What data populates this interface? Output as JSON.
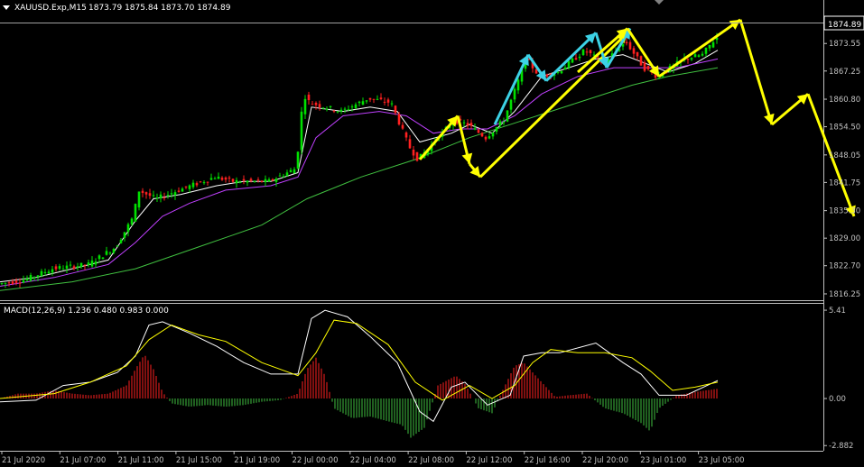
{
  "window": {
    "symbol": "XAUUSD.Exp,M15",
    "ohlc": "1873.79 1875.84 1873.70 1874.89",
    "current_price": "1874.89",
    "menu_arrow": "triangle-down-icon"
  },
  "colors": {
    "background": "#000000",
    "axis": "#c0c0c0",
    "bull": "#00e000",
    "bear": "#ff2020",
    "ma_fast": "#ffffff",
    "ma_slow": "#c040ff",
    "ma_long": "#40c040",
    "arrow_yellow": "#ffff00",
    "arrow_cyan": "#3cd2e6",
    "macd_line": "#ffffff",
    "signal_line": "#ffff00"
  },
  "chart_data": [
    {
      "type": "candlestick",
      "title": "XAUUSD.Exp,M15",
      "y_ticks": [
        "1873.55",
        "1867.25",
        "1860.80",
        "1854.50",
        "1848.05",
        "1841.75",
        "1835.30",
        "1829.00",
        "1822.70",
        "1816.25"
      ],
      "ylim": [
        1814.8,
        1880.2
      ],
      "x_ticks": [
        "21 Jul 2020",
        "21 Jul 07:00",
        "21 Jul 11:00",
        "21 Jul 15:00",
        "21 Jul 19:00",
        "22 Jul 00:00",
        "22 Jul 04:00",
        "22 Jul 08:00",
        "22 Jul 12:00",
        "22 Jul 16:00",
        "22 Jul 20:00",
        "23 Jul 01:00",
        "23 Jul 05:00"
      ],
      "price_path": [
        [
          0,
          1818.5
        ],
        [
          30,
          1819.5
        ],
        [
          60,
          1822
        ],
        [
          100,
          1823
        ],
        [
          130,
          1827
        ],
        [
          150,
          1834
        ],
        [
          155,
          1840
        ],
        [
          175,
          1838
        ],
        [
          200,
          1840
        ],
        [
          240,
          1843
        ],
        [
          260,
          1842
        ],
        [
          300,
          1842
        ],
        [
          330,
          1845
        ],
        [
          338,
          1862
        ],
        [
          345,
          1860
        ],
        [
          380,
          1858
        ],
        [
          410,
          1861
        ],
        [
          435,
          1860
        ],
        [
          455,
          1850
        ],
        [
          465,
          1847
        ],
        [
          505,
          1856
        ],
        [
          520,
          1855
        ],
        [
          540,
          1852
        ],
        [
          560,
          1856
        ],
        [
          585,
          1870
        ],
        [
          600,
          1866
        ],
        [
          620,
          1867
        ],
        [
          650,
          1872
        ],
        [
          670,
          1869
        ],
        [
          695,
          1874
        ],
        [
          715,
          1868
        ],
        [
          730,
          1866
        ],
        [
          760,
          1870
        ],
        [
          780,
          1871
        ],
        [
          795,
          1874.9
        ]
      ],
      "indicators": [
        {
          "name": "ma_fast",
          "color": "#ffffff",
          "values": [
            [
              0,
              1819
            ],
            [
              40,
              1820
            ],
            [
              80,
              1822
            ],
            [
              120,
              1824
            ],
            [
              150,
              1833
            ],
            [
              170,
              1838
            ],
            [
              200,
              1839
            ],
            [
              240,
              1841
            ],
            [
              270,
              1842
            ],
            [
              300,
              1842
            ],
            [
              330,
              1844
            ],
            [
              345,
              1859
            ],
            [
              380,
              1858
            ],
            [
              410,
              1859
            ],
            [
              440,
              1858
            ],
            [
              465,
              1851
            ],
            [
              500,
              1853
            ],
            [
              520,
              1855
            ],
            [
              545,
              1853
            ],
            [
              570,
              1858
            ],
            [
              600,
              1866
            ],
            [
              630,
              1868
            ],
            [
              660,
              1870
            ],
            [
              690,
              1871
            ],
            [
              715,
              1869
            ],
            [
              740,
              1867
            ],
            [
              770,
              1869
            ],
            [
              795,
              1872
            ]
          ]
        },
        {
          "name": "ma_slow",
          "color": "#c040ff",
          "values": [
            [
              0,
              1818
            ],
            [
              60,
              1820
            ],
            [
              120,
              1823
            ],
            [
              150,
              1828
            ],
            [
              180,
              1834
            ],
            [
              210,
              1837
            ],
            [
              250,
              1840
            ],
            [
              300,
              1841
            ],
            [
              330,
              1843
            ],
            [
              350,
              1852
            ],
            [
              380,
              1857
            ],
            [
              420,
              1858
            ],
            [
              450,
              1857
            ],
            [
              480,
              1853
            ],
            [
              510,
              1854
            ],
            [
              540,
              1854
            ],
            [
              570,
              1857
            ],
            [
              600,
              1862
            ],
            [
              640,
              1866
            ],
            [
              680,
              1868
            ],
            [
              720,
              1868
            ],
            [
              750,
              1868
            ],
            [
              795,
              1870
            ]
          ]
        },
        {
          "name": "ma_long",
          "color": "#40c040",
          "values": [
            [
              0,
              1817
            ],
            [
              80,
              1819
            ],
            [
              150,
              1822
            ],
            [
              220,
              1827
            ],
            [
              290,
              1832
            ],
            [
              340,
              1838
            ],
            [
              400,
              1843
            ],
            [
              460,
              1847
            ],
            [
              520,
              1852
            ],
            [
              580,
              1856
            ],
            [
              640,
              1860
            ],
            [
              700,
              1864
            ],
            [
              740,
              1866
            ],
            [
              795,
              1868
            ]
          ]
        }
      ],
      "arrows": [
        {
          "color": "#ffff00",
          "points": [
            [
              465,
              1847
            ],
            [
              507,
              1857
            ]
          ]
        },
        {
          "color": "#ffff00",
          "points": [
            [
              507,
              1857
            ],
            [
              520,
              1846
            ]
          ]
        },
        {
          "color": "#ffff00",
          "points": [
            [
              520,
              1846
            ],
            [
              532,
              1843
            ]
          ]
        },
        {
          "color": "#ffff00",
          "points": [
            [
              532,
              1843
            ],
            [
              695,
              1876
            ]
          ]
        },
        {
          "color": "#3cd2e6",
          "points": [
            [
              548,
              1855
            ],
            [
              585,
              1871
            ]
          ]
        },
        {
          "color": "#3cd2e6",
          "points": [
            [
              585,
              1871
            ],
            [
              605,
              1865
            ]
          ]
        },
        {
          "color": "#3cd2e6",
          "points": [
            [
              605,
              1865
            ],
            [
              660,
              1876
            ]
          ]
        },
        {
          "color": "#3cd2e6",
          "points": [
            [
              660,
              1876
            ],
            [
              672,
              1868
            ]
          ]
        },
        {
          "color": "#3cd2e6",
          "points": [
            [
              672,
              1868
            ],
            [
              698,
              1877
            ]
          ]
        },
        {
          "color": "#ffff00",
          "points": [
            [
              640,
              1867
            ],
            [
              695,
              1877
            ]
          ]
        },
        {
          "color": "#ffff00",
          "points": [
            [
              695,
              1877
            ],
            [
              730,
              1866
            ]
          ]
        },
        {
          "color": "#ffff00",
          "points": [
            [
              730,
              1866
            ],
            [
              820,
              1879
            ]
          ]
        },
        {
          "color": "#ffff00",
          "points": [
            [
              820,
              1879
            ],
            [
              855,
              1855
            ]
          ]
        },
        {
          "color": "#ffff00",
          "points": [
            [
              855,
              1855
            ],
            [
              895,
              1862
            ]
          ]
        },
        {
          "color": "#ffff00",
          "points": [
            [
              895,
              1862
            ],
            [
              946,
              1834
            ]
          ]
        }
      ]
    },
    {
      "type": "line",
      "title": "MACD(12,26,9) 1.236 0.480 0.983 0.000",
      "y_ticks": [
        "5.41",
        "0.00",
        "-2.882"
      ],
      "ylim": [
        -3.2,
        5.8
      ],
      "series": [
        {
          "name": "MACD",
          "color": "#ffffff",
          "values": [
            [
              0,
              -0.2
            ],
            [
              40,
              -0.1
            ],
            [
              70,
              0.8
            ],
            [
              100,
              1.0
            ],
            [
              130,
              1.6
            ],
            [
              150,
              2.6
            ],
            [
              165,
              4.5
            ],
            [
              180,
              4.7
            ],
            [
              210,
              4.0
            ],
            [
              240,
              3.2
            ],
            [
              270,
              2.2
            ],
            [
              300,
              1.5
            ],
            [
              330,
              1.5
            ],
            [
              345,
              4.9
            ],
            [
              360,
              5.4
            ],
            [
              385,
              5.0
            ],
            [
              410,
              3.8
            ],
            [
              440,
              2.2
            ],
            [
              465,
              -0.8
            ],
            [
              480,
              -1.4
            ],
            [
              500,
              0.7
            ],
            [
              515,
              1.0
            ],
            [
              540,
              -0.4
            ],
            [
              565,
              0.2
            ],
            [
              580,
              2.6
            ],
            [
              600,
              2.8
            ],
            [
              620,
              2.8
            ],
            [
              660,
              3.4
            ],
            [
              690,
              2.2
            ],
            [
              710,
              1.5
            ],
            [
              730,
              0.2
            ],
            [
              760,
              0.2
            ],
            [
              795,
              1.1
            ]
          ]
        },
        {
          "name": "Signal",
          "color": "#ffff00",
          "values": [
            [
              0,
              0
            ],
            [
              60,
              0.3
            ],
            [
              100,
              1.0
            ],
            [
              140,
              2.0
            ],
            [
              165,
              3.6
            ],
            [
              190,
              4.5
            ],
            [
              220,
              3.9
            ],
            [
              250,
              3.5
            ],
            [
              290,
              2.2
            ],
            [
              330,
              1.4
            ],
            [
              350,
              2.8
            ],
            [
              370,
              4.8
            ],
            [
              395,
              4.6
            ],
            [
              430,
              3.3
            ],
            [
              460,
              1.0
            ],
            [
              490,
              -0.1
            ],
            [
              520,
              0.8
            ],
            [
              545,
              0.0
            ],
            [
              570,
              0.8
            ],
            [
              590,
              2.2
            ],
            [
              610,
              3.0
            ],
            [
              640,
              2.8
            ],
            [
              670,
              2.8
            ],
            [
              700,
              2.5
            ],
            [
              720,
              1.7
            ],
            [
              745,
              0.5
            ],
            [
              770,
              0.7
            ],
            [
              795,
              1.0
            ]
          ]
        }
      ],
      "histogram": [
        [
          0,
          0
        ],
        [
          20,
          0.3
        ],
        [
          40,
          0.3
        ],
        [
          60,
          0.5
        ],
        [
          80,
          0.3
        ],
        [
          100,
          0.2
        ],
        [
          120,
          0.3
        ],
        [
          140,
          0.8
        ],
        [
          150,
          1.8
        ],
        [
          160,
          2.7
        ],
        [
          170,
          1.8
        ],
        [
          180,
          0.4
        ],
        [
          190,
          -0.3
        ],
        [
          210,
          -0.5
        ],
        [
          230,
          -0.4
        ],
        [
          250,
          -0.5
        ],
        [
          270,
          -0.4
        ],
        [
          290,
          -0.2
        ],
        [
          310,
          -0.1
        ],
        [
          330,
          0.3
        ],
        [
          340,
          1.8
        ],
        [
          350,
          2.5
        ],
        [
          360,
          1.4
        ],
        [
          370,
          -0.6
        ],
        [
          390,
          -1.2
        ],
        [
          410,
          -1.1
        ],
        [
          430,
          -1.4
        ],
        [
          445,
          -1.6
        ],
        [
          455,
          -2.4
        ],
        [
          470,
          -1.8
        ],
        [
          485,
          0.8
        ],
        [
          495,
          1.1
        ],
        [
          505,
          1.4
        ],
        [
          515,
          0.9
        ],
        [
          530,
          -0.6
        ],
        [
          545,
          -0.9
        ],
        [
          555,
          0.3
        ],
        [
          570,
          2.0
        ],
        [
          580,
          2.2
        ],
        [
          600,
          1.0
        ],
        [
          615,
          0.1
        ],
        [
          630,
          0.2
        ],
        [
          650,
          0.3
        ],
        [
          670,
          -0.6
        ],
        [
          690,
          -0.9
        ],
        [
          710,
          -1.5
        ],
        [
          720,
          -2.0
        ],
        [
          730,
          -0.6
        ],
        [
          750,
          0.2
        ],
        [
          770,
          0.4
        ],
        [
          795,
          0.6
        ]
      ]
    }
  ]
}
